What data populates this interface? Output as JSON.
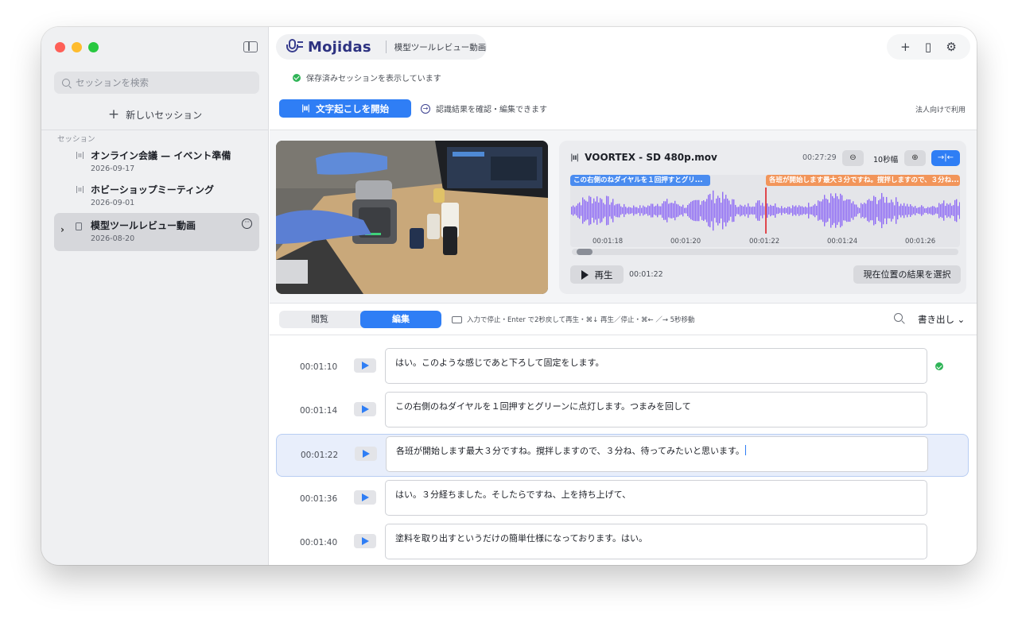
{
  "sidebar": {
    "search_placeholder": "セッションを検索",
    "new_session_label": "新しいセッション",
    "section_label": "セッション",
    "sessions": [
      {
        "title": "オンライン会議 — イベント準備",
        "date": "2026-09-17",
        "icon": "waveform-icon"
      },
      {
        "title": "ホビーショップミーティング",
        "date": "2026-09-01",
        "icon": "waveform-icon"
      },
      {
        "title": "模型ツールレビュー動画",
        "date": "2026-08-20",
        "icon": "document-icon",
        "selected": true
      }
    ]
  },
  "header": {
    "app_name": "Mojidas",
    "session_title": "模型ツールレビュー動画",
    "status_text": "保存済みセッションを表示しています",
    "start_button_label": "文字起こしを開始",
    "review_hint": "認識結果を確認・編集できます",
    "corporate_link": "法人向けで利用"
  },
  "audio": {
    "file_name": "VOORTEX - SD 480p.mov",
    "duration": "00:27:29",
    "zoom_label": "10秒幅",
    "segment_1": "この右側のねダイヤルを１回押すとグリ...",
    "segment_2": "各班が開始します最大３分ですね。撹拌しますので、３分ね...",
    "ticks": [
      "00:01:18",
      "00:01:20",
      "00:01:22",
      "00:01:24",
      "00:01:26"
    ],
    "play_label": "再生",
    "current_time": "00:01:22",
    "select_label": "現在位置の結果を選択"
  },
  "tabs": {
    "view": "閲覧",
    "edit": "編集",
    "keyboard_hint": "入力で停止・Enter で2秒戻して再生・⌘↓ 再生／停止・⌘← ／→ 5秒移動",
    "export_label": "書き出し ⌄"
  },
  "transcript": [
    {
      "time": "00:01:10",
      "text": "はい。このような感じであと下ろして固定をします。",
      "done": true
    },
    {
      "time": "00:01:14",
      "text": "この右側のねダイヤルを１回押すとグリーンに点灯します。つまみを回して"
    },
    {
      "time": "00:01:22",
      "text": "各班が開始します最大３分ですね。撹拌しますので、３分ね、待ってみたいと思います。",
      "active": true
    },
    {
      "time": "00:01:36",
      "text": "はい。３分経ちました。そしたらですね、上を持ち上げて、"
    },
    {
      "time": "00:01:40",
      "text": "塗料を取り出すというだけの簡単仕様になっております。はい。"
    }
  ],
  "colors": {
    "accent": "#2f7ef5",
    "waveform": "#8f6cf5",
    "playhead": "#e0474c",
    "segment_blue": "#4a8cf0",
    "segment_orange": "#f2955a",
    "success": "#2fb457"
  }
}
